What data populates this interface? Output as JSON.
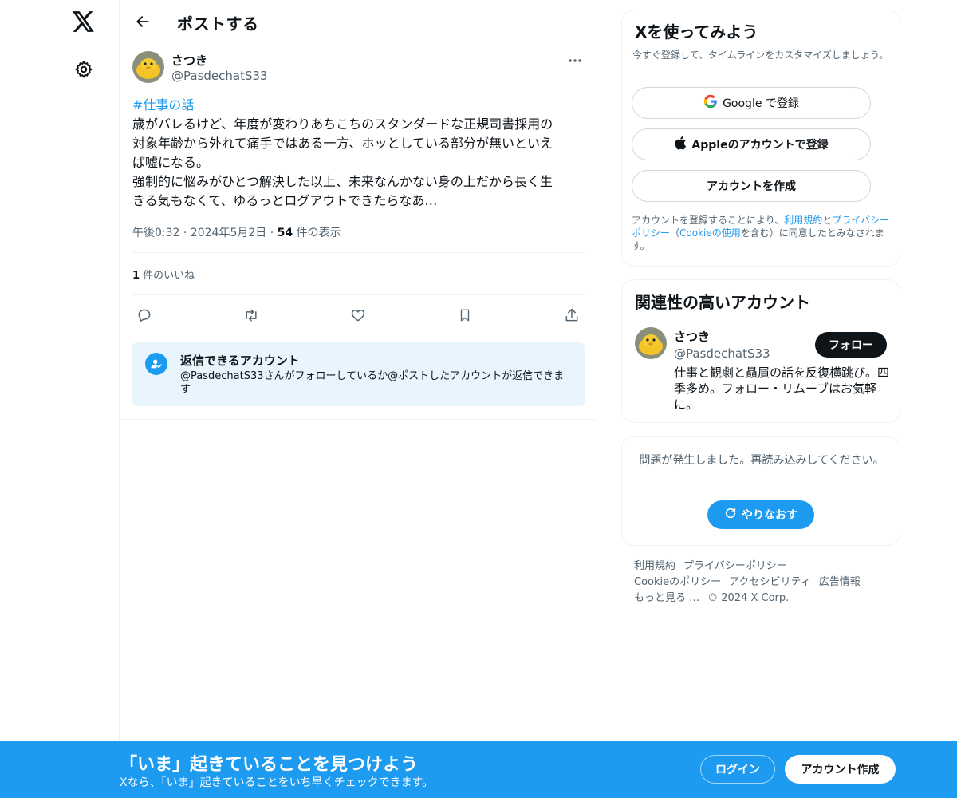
{
  "nav": {
    "logo_icon": "x-logo-icon",
    "settings_icon": "gear-icon"
  },
  "header": {
    "title": "ポストする"
  },
  "tweet": {
    "author_name": "さつき",
    "author_handle": "@PasdechatS33",
    "hashtag": "#仕事の話",
    "lines": [
      "歳がバレるけど、年度が変わりあちこちのスタンダードな正規司書採用の",
      "対象年齢から外れて痛手ではある一方、ホッとしている部分が無いといえ",
      "ば嘘になる。",
      "強制的に悩みがひとつ解決した以上、未来なんかない身の上だから長く生",
      "きる気もなくて、ゆるっとログアウトできたらなあ…"
    ],
    "time": "午後0:32",
    "date": "2024年5月2日",
    "separator": "·",
    "views_count": "54",
    "views_label": " 件の表示",
    "likes_count": "1",
    "likes_label": " 件のいいね"
  },
  "reply_notice": {
    "title": "返信できるアカウント",
    "description": "@PasdechatS33さんがフォローしているか@ポストしたアカウントが返信できます"
  },
  "signup": {
    "title": "Xを使ってみよう",
    "subtitle": "今すぐ登録して、タイムラインをカスタマイズしましょう。",
    "google_label": "Google で登録",
    "apple_label": "Appleのアカウントで登録",
    "create_label": "アカウントを作成",
    "legal_1": "アカウントを登録することにより、",
    "legal_terms": "利用規約",
    "legal_2": "と",
    "legal_privacy": "プライバシーポリシー",
    "legal_3": "（",
    "legal_cookie": "Cookieの使用",
    "legal_4": "を含む）に同意したとみなされます。"
  },
  "related": {
    "title": "関連性の高いアカウント",
    "name": "さつき",
    "handle": "@PasdechatS33",
    "follow_label": "フォロー",
    "bio": "仕事と観劇と贔屓の話を反復横跳び。四季多め。フォロー・リムーブはお気軽に。"
  },
  "error": {
    "message": "問題が発生しました。再読み込みしてください。",
    "retry_label": "やりなおす"
  },
  "footer": {
    "terms": "利用規約",
    "privacy": "プライバシーポリシー",
    "cookie": "Cookieのポリシー",
    "accessibility": "アクセシビリティ",
    "ads": "広告情報",
    "more": "もっと見る …",
    "copyright": "© 2024 X Corp."
  },
  "banner": {
    "title": "「いま」起きていることを見つけよう",
    "subtitle": "Xなら、「いま」起きていることをいち早くチェックできます。",
    "login_label": "ログイン",
    "create_label": "アカウント作成"
  },
  "colors": {
    "accent": "#1d9bf0",
    "text": "#0f1419",
    "muted": "#536471",
    "border": "#eff3f4"
  }
}
